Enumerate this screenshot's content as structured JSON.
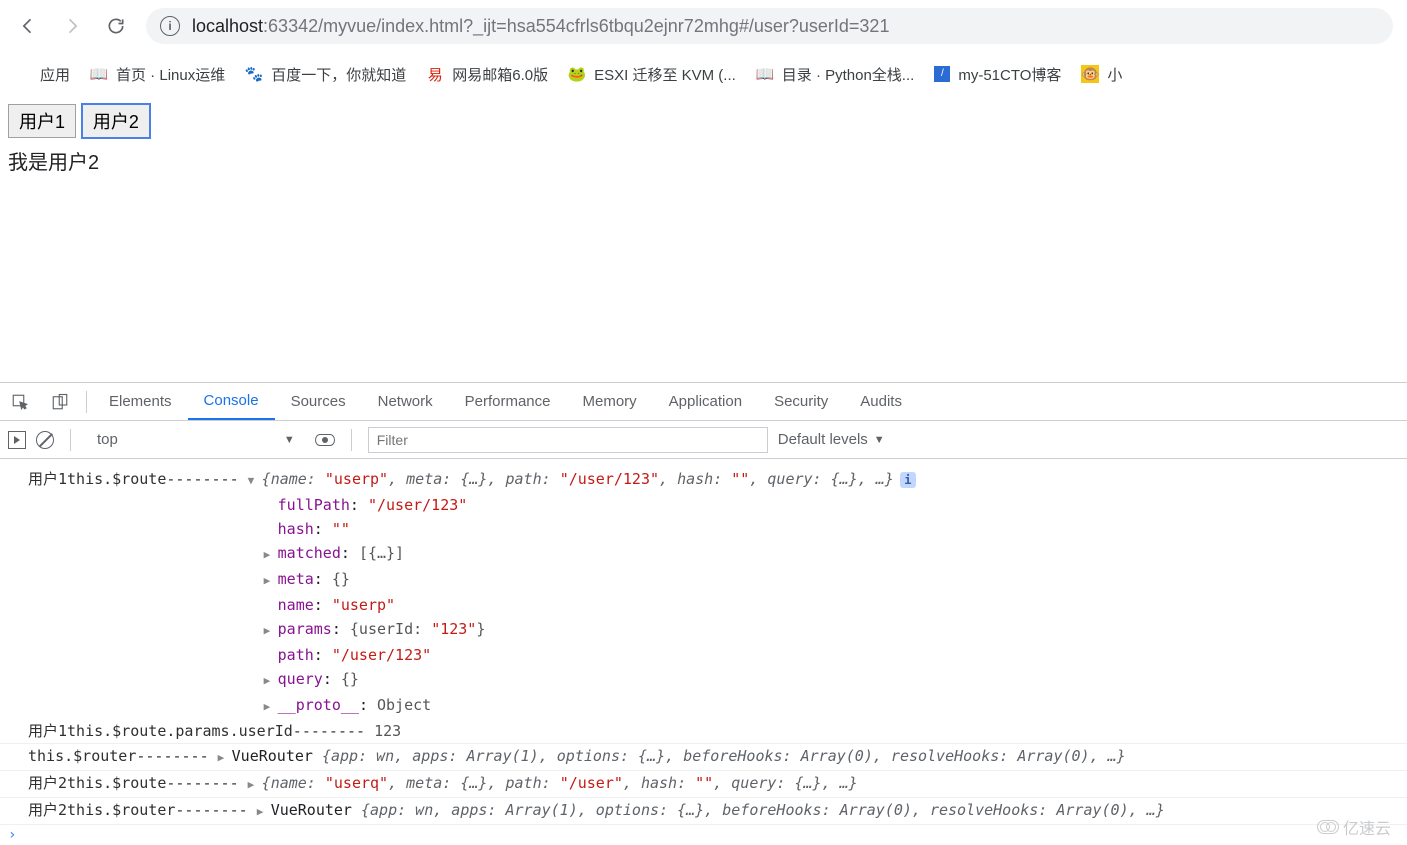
{
  "browser": {
    "url_host": "localhost",
    "url_path": ":63342/myvue/index.html?_ijt=hsa554cfrls6tbqu2ejnr72mhg#/user?userId=321"
  },
  "bookmarks": {
    "apps": "应用",
    "items": [
      {
        "label": "首页 · Linux运维",
        "icon": "book-icon"
      },
      {
        "label": "百度一下，你就知道",
        "icon": "baidu-icon"
      },
      {
        "label": "网易邮箱6.0版",
        "icon": "netease-icon"
      },
      {
        "label": "ESXI 迁移至 KVM (...",
        "icon": "frog-icon"
      },
      {
        "label": "目录 · Python全栈...",
        "icon": "book-icon"
      },
      {
        "label": "my-51CTO博客",
        "icon": "cto-icon"
      },
      {
        "label": "小",
        "icon": "monkey-icon"
      }
    ]
  },
  "page": {
    "btn1": "用户1",
    "btn2": "用户2",
    "content": "我是用户2"
  },
  "devtools": {
    "tabs": [
      "Elements",
      "Console",
      "Sources",
      "Network",
      "Performance",
      "Memory",
      "Application",
      "Security",
      "Audits"
    ],
    "active_tab": "Console",
    "context": "top",
    "filter_placeholder": "Filter",
    "levels": "Default levels"
  },
  "console": {
    "entries": [
      {
        "label": "用户1this.$route-------- ",
        "expanded": true,
        "summary_pre": "{",
        "summary_parts": [
          {
            "k": "name",
            "v": "\"userp\"",
            "t": "str"
          },
          {
            "k": "meta",
            "v": "{…}",
            "t": "pale"
          },
          {
            "k": "path",
            "v": "\"/user/123\"",
            "t": "str"
          },
          {
            "k": "hash",
            "v": "\"\"",
            "t": "str"
          },
          {
            "k": "query",
            "v": "{…}",
            "t": "pale"
          }
        ],
        "summary_post": ", …}",
        "props": [
          {
            "key": "fullPath",
            "value": "\"/user/123\"",
            "type": "str"
          },
          {
            "key": "hash",
            "value": "\"\"",
            "type": "str"
          },
          {
            "key": "matched",
            "value": "[{…}]",
            "type": "blk",
            "arrow": true
          },
          {
            "key": "meta",
            "value": "{}",
            "type": "blk",
            "arrow": true
          },
          {
            "key": "name",
            "value": "\"userp\"",
            "type": "str"
          },
          {
            "key": "params",
            "value": "{userId: \"123\"}",
            "type": "mixed",
            "arrow": true
          },
          {
            "key": "path",
            "value": "\"/user/123\"",
            "type": "str"
          },
          {
            "key": "query",
            "value": "{}",
            "type": "blk",
            "arrow": true
          },
          {
            "key": "__proto__",
            "value": "Object",
            "type": "blk",
            "arrow": true
          }
        ]
      },
      {
        "label": "用户1this.$route.params.userId-------- ",
        "plain_value": "123"
      },
      {
        "label": "this.$router-------- ",
        "collapsed_summary": "VueRouter {app: wn, apps: Array(1), options: {…}, beforeHooks: Array(0), resolveHooks: Array(0), …}"
      },
      {
        "label": "用户2this.$route-------- ",
        "summary_pre": "{",
        "summary_parts": [
          {
            "k": "name",
            "v": "\"userq\"",
            "t": "str"
          },
          {
            "k": "meta",
            "v": "{…}",
            "t": "pale"
          },
          {
            "k": "path",
            "v": "\"/user\"",
            "t": "str"
          },
          {
            "k": "hash",
            "v": "\"\"",
            "t": "str"
          },
          {
            "k": "query",
            "v": "{…}",
            "t": "pale"
          }
        ],
        "summary_post": ", …}"
      },
      {
        "label": "用户2this.$router-------- ",
        "collapsed_summary": "VueRouter {app: wn, apps: Array(1), options: {…}, beforeHooks: Array(0), resolveHooks: Array(0), …}"
      }
    ]
  },
  "watermark": "亿速云"
}
